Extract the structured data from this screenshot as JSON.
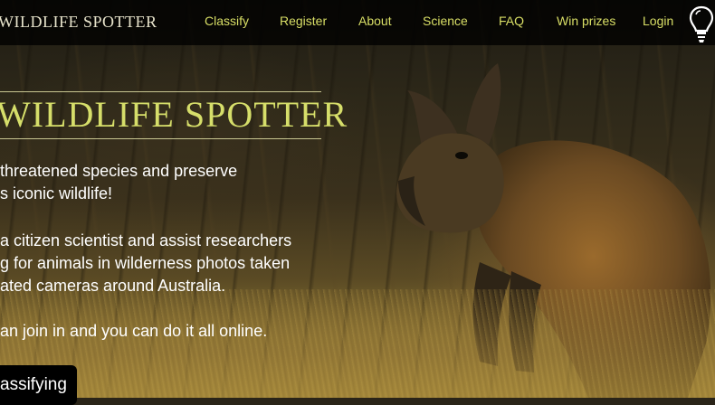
{
  "brand": {
    "name": "WILDLIFE SPOTTER"
  },
  "nav": {
    "items": [
      {
        "label": "Classify"
      },
      {
        "label": "Register"
      },
      {
        "label": "About"
      },
      {
        "label": "Science"
      },
      {
        "label": "FAQ"
      },
      {
        "label": "Win prizes"
      },
      {
        "label": "Login"
      }
    ],
    "icon": "lightbulb-icon"
  },
  "hero": {
    "title": "WILDLIFE SPOTTER",
    "lines": [
      "threatened species and preserve",
      "s iconic wildlife!",
      "a citizen scientist and assist researchers",
      "g for animals in wilderness photos taken",
      "ated cameras around Australia.",
      "an join in and you can do it all online."
    ],
    "cta_label": "assifying"
  },
  "colors": {
    "accent": "#d9df66",
    "topbar": "#000000"
  }
}
